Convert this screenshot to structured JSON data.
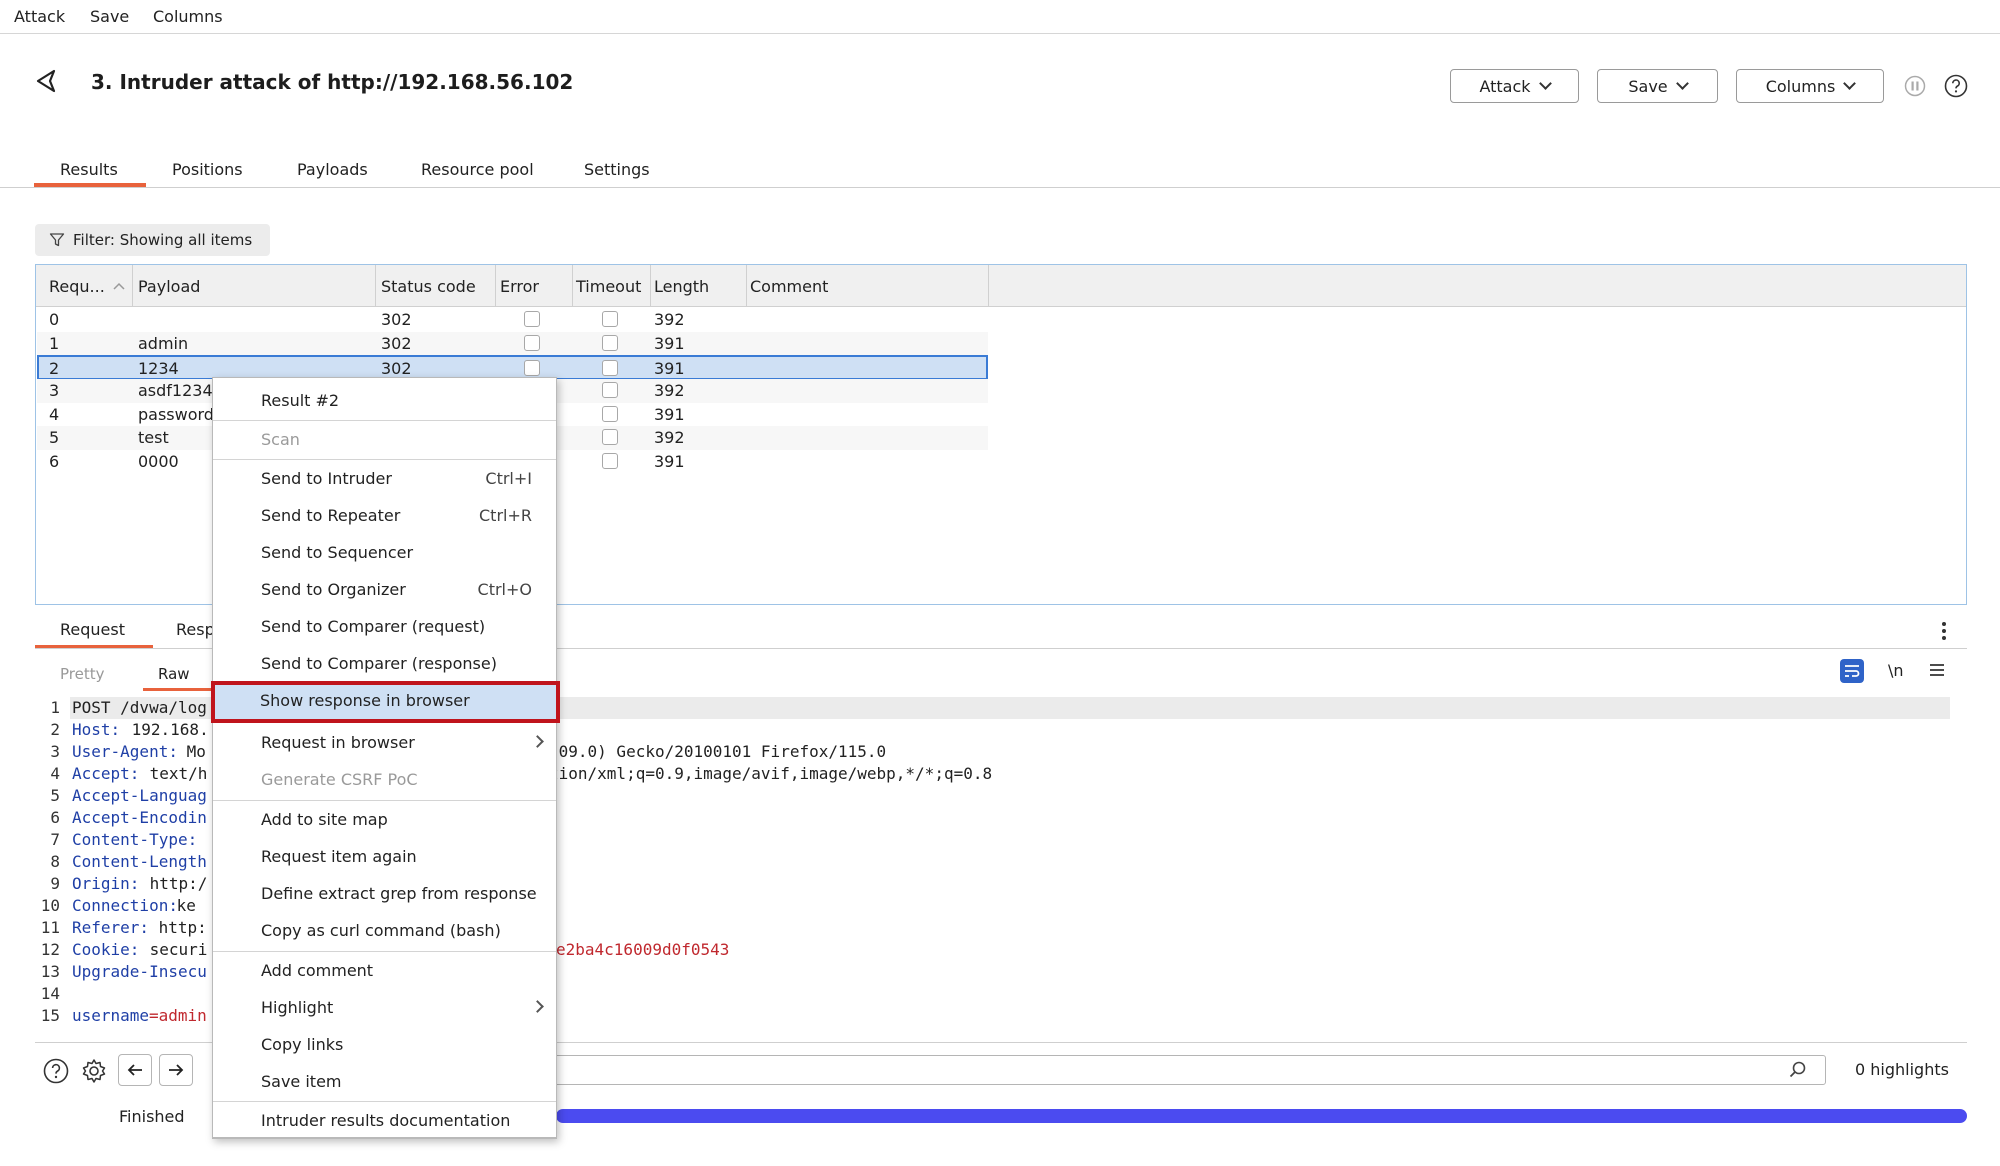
{
  "menubar": {
    "items": [
      "Attack",
      "Save",
      "Columns"
    ]
  },
  "header": {
    "title": "3. Intruder attack of http://192.168.56.102",
    "buttons": {
      "attack": "Attack",
      "save": "Save",
      "columns": "Columns"
    }
  },
  "tabs": [
    "Results",
    "Positions",
    "Payloads",
    "Resource pool",
    "Settings"
  ],
  "filter": {
    "label": "Filter: Showing all items"
  },
  "table": {
    "columns": [
      "Requ...",
      "Payload",
      "Status code",
      "Error",
      "Timeout",
      "Length",
      "Comment"
    ],
    "rows": [
      {
        "req": "0",
        "payload": "",
        "status": "302",
        "length": "392"
      },
      {
        "req": "1",
        "payload": "admin",
        "status": "302",
        "length": "391"
      },
      {
        "req": "2",
        "payload": "1234",
        "status": "302",
        "length": "391"
      },
      {
        "req": "3",
        "payload": "asdf1234",
        "status": "",
        "length": "392"
      },
      {
        "req": "4",
        "payload": "password",
        "status": "",
        "length": "391"
      },
      {
        "req": "5",
        "payload": "test",
        "status": "",
        "length": "392"
      },
      {
        "req": "6",
        "payload": "0000",
        "status": "",
        "length": "391"
      }
    ]
  },
  "lower": {
    "tabs": [
      "Request",
      "Resp"
    ],
    "subtabs": [
      "Pretty",
      "Raw"
    ],
    "right_icons": {
      "wrap": "\\n"
    },
    "lines": [
      {
        "n": "1",
        "key": "",
        "val": "POST /dvwa/log",
        "tail": ""
      },
      {
        "n": "2",
        "key": "Host:",
        "val": " 192.168.",
        "tail": ""
      },
      {
        "n": "3",
        "key": "User-Agent:",
        "val": " Mo",
        "tail": ".09.0) Gecko/20100101 Firefox/115.0"
      },
      {
        "n": "4",
        "key": "Accept:",
        "val": " text/h",
        "tail": "tion/xml;q=0.9,image/avif,image/webp,*/*;q=0.8"
      },
      {
        "n": "5",
        "key": "Accept-Languag",
        "val": "",
        "tail": ""
      },
      {
        "n": "6",
        "key": "Accept-Encodin",
        "val": "",
        "tail": ""
      },
      {
        "n": "7",
        "key": "Content-Type:",
        "val": "",
        "tail": ""
      },
      {
        "n": "8",
        "key": "Content-Length",
        "val": "",
        "tail": ""
      },
      {
        "n": "9",
        "key": "Origin:",
        "val": " http:/",
        "tail": ""
      },
      {
        "n": "10",
        "key": "Connection:",
        "val": " ke",
        "tail": ""
      },
      {
        "n": "11",
        "key": "Referer:",
        "val": " http:",
        "tail": ""
      },
      {
        "n": "12",
        "key": "Cookie:",
        "val": " securi",
        "tail": "e2ba4c16009d0f0543"
      },
      {
        "n": "13",
        "key": "Upgrade-Insecu",
        "val": "",
        "tail": ""
      },
      {
        "n": "14",
        "key": "",
        "val": "",
        "tail": ""
      },
      {
        "n": "15",
        "key": "username",
        "val": "=admin",
        "tail": ""
      }
    ],
    "highlights": "0 highlights",
    "status": "Finished"
  },
  "context_menu": {
    "items": [
      {
        "label": "Result #2",
        "shortcut": ""
      },
      {
        "label": "Scan",
        "shortcut": ""
      },
      {
        "label": "Send to Intruder",
        "shortcut": "Ctrl+I"
      },
      {
        "label": "Send to Repeater",
        "shortcut": "Ctrl+R"
      },
      {
        "label": "Send to Sequencer",
        "shortcut": ""
      },
      {
        "label": "Send to Organizer",
        "shortcut": "Ctrl+O"
      },
      {
        "label": "Send to Comparer (request)",
        "shortcut": ""
      },
      {
        "label": "Send to Comparer (response)",
        "shortcut": ""
      },
      {
        "label": "Show response in browser",
        "shortcut": ""
      },
      {
        "label": "Request in browser",
        "shortcut": ""
      },
      {
        "label": "Generate CSRF PoC",
        "shortcut": ""
      },
      {
        "label": "Add to site map",
        "shortcut": ""
      },
      {
        "label": "Request item again",
        "shortcut": ""
      },
      {
        "label": "Define extract grep from response",
        "shortcut": ""
      },
      {
        "label": "Copy as curl command (bash)",
        "shortcut": ""
      },
      {
        "label": "Add comment",
        "shortcut": ""
      },
      {
        "label": "Highlight",
        "shortcut": ""
      },
      {
        "label": "Copy links",
        "shortcut": ""
      },
      {
        "label": "Save item",
        "shortcut": ""
      },
      {
        "label": "Intruder results documentation",
        "shortcut": ""
      }
    ]
  }
}
